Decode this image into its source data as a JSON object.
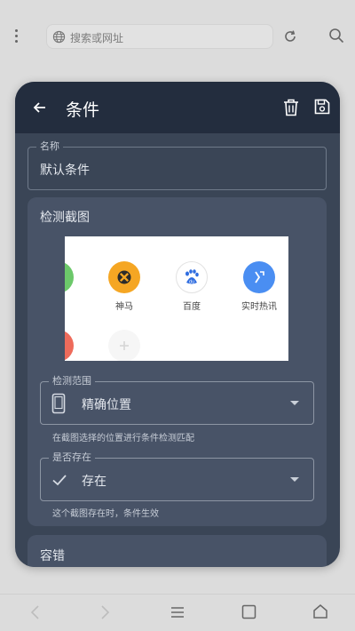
{
  "browser": {
    "search_placeholder": "搜索或网址",
    "icons": [
      "more-vert-icon",
      "globe-icon",
      "reload-icon",
      "search-icon"
    ]
  },
  "dialog": {
    "title": "条件",
    "name_field": {
      "label": "名称",
      "value": "默认条件"
    },
    "detect_card": {
      "title": "检测截图",
      "screenshot": {
        "apps": [
          {
            "label": "神马",
            "color": "#f5a623",
            "icon": "xbox-icon"
          },
          {
            "label": "百度",
            "color": "#ffffff",
            "icon": "baidu-paw-icon"
          },
          {
            "label": "实时热讯",
            "color": "#4a8ef2",
            "icon": "arrow-icon"
          }
        ]
      },
      "range": {
        "label": "检测范围",
        "value": "精确位置",
        "hint": "在截图选择的位置进行条件检测匹配",
        "icon": "phone-icon"
      },
      "exists": {
        "label": "是否存在",
        "value": "存在",
        "hint": "这个截图存在时，条件生效",
        "icon": "check-icon"
      }
    },
    "tolerance_card": {
      "title": "容错"
    }
  },
  "bottom_nav": {
    "icons": [
      "nav-back-icon",
      "nav-forward-icon",
      "menu-icon",
      "tabs-icon",
      "home-icon"
    ]
  }
}
